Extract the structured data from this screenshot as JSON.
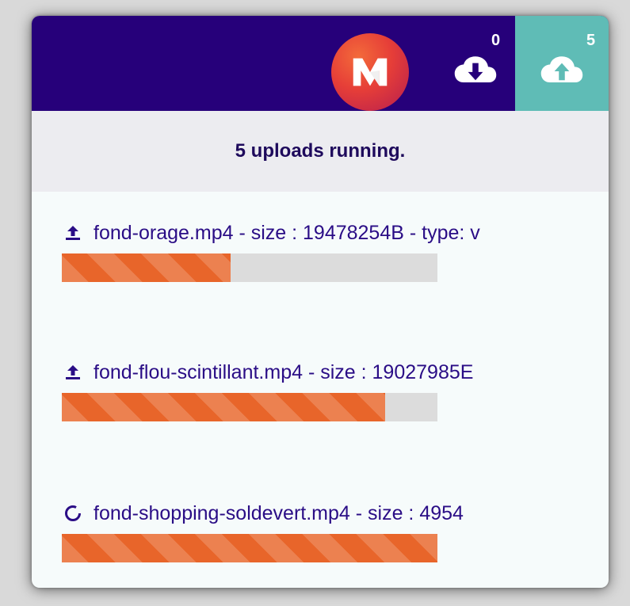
{
  "header": {
    "logo_label": "M",
    "download_count": "0",
    "upload_count": "5"
  },
  "status": {
    "message": "5 uploads running."
  },
  "uploads": [
    {
      "label": "fond-orage.mp4 - size : 19478254B - type: v",
      "progress_fraction": 0.45,
      "state_icon": "upload-icon"
    },
    {
      "label": "fond-flou-scintillant.mp4 - size : 19027985E",
      "progress_fraction": 0.86,
      "state_icon": "upload-icon"
    },
    {
      "label": "fond-shopping-soldevert.mp4 - size : 4954",
      "progress_fraction": 1.0,
      "state_icon": "loading-spinner-icon"
    }
  ],
  "colors": {
    "header_bg": "#26007a",
    "upload_tab_bg": "#5fbcb6",
    "progress_fill": "#e8652a",
    "progress_track": "#dcdcdc",
    "text_primary": "#2a0d86"
  }
}
